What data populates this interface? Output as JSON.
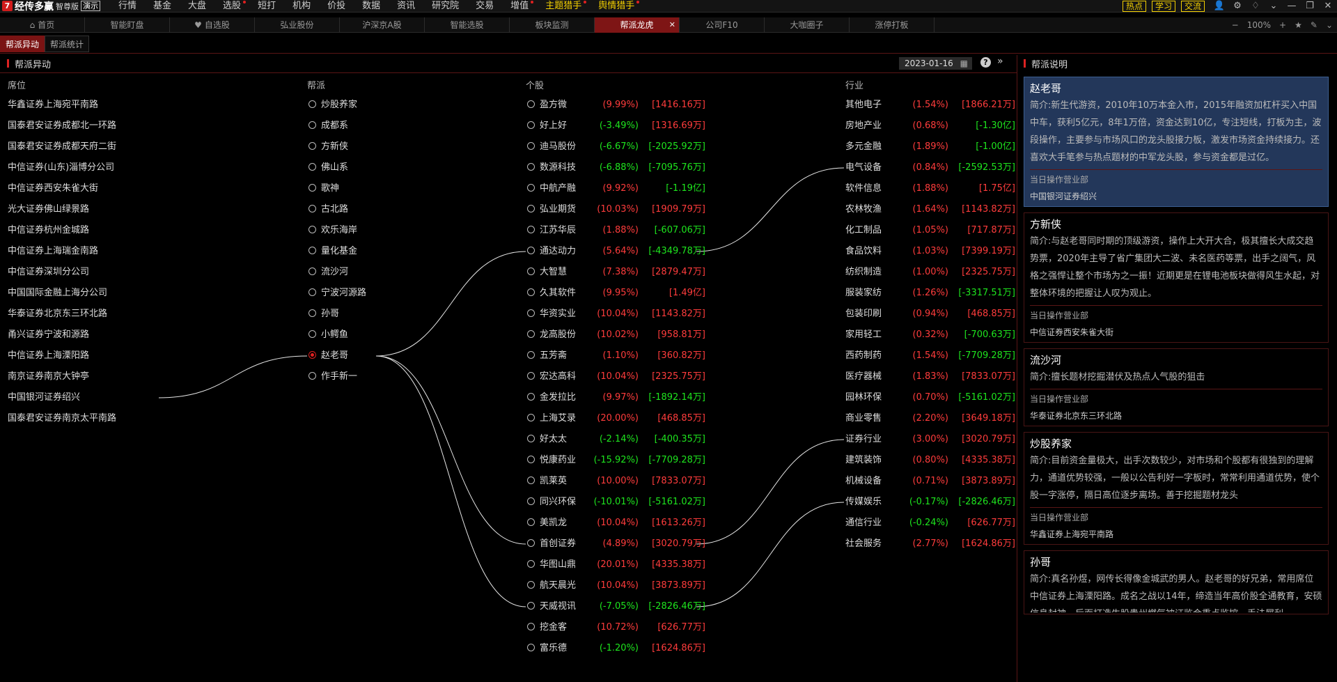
{
  "app": {
    "logo_glyph": "7",
    "name": "经传多赢",
    "edition": "智尊版",
    "demo": "演示"
  },
  "menu": [
    {
      "label": "行情",
      "dot": false,
      "hl": false
    },
    {
      "label": "基金",
      "dot": false,
      "hl": false
    },
    {
      "label": "大盘",
      "dot": false,
      "hl": false
    },
    {
      "label": "选股",
      "dot": true,
      "hl": false
    },
    {
      "label": "短打",
      "dot": false,
      "hl": false
    },
    {
      "label": "机构",
      "dot": false,
      "hl": false
    },
    {
      "label": "价投",
      "dot": false,
      "hl": false
    },
    {
      "label": "数据",
      "dot": false,
      "hl": false
    },
    {
      "label": "资讯",
      "dot": false,
      "hl": false
    },
    {
      "label": "研究院",
      "dot": false,
      "hl": false
    },
    {
      "label": "交易",
      "dot": false,
      "hl": false
    },
    {
      "label": "增值",
      "dot": true,
      "hl": false
    },
    {
      "label": "主题猎手",
      "dot": true,
      "hl": true
    },
    {
      "label": "舆情猎手",
      "dot": true,
      "hl": true
    }
  ],
  "top_buttons": [
    "热点",
    "学习",
    "交流"
  ],
  "top_icons": [
    "user-icon",
    "gear-icon",
    "skin-icon",
    "chevron-down-icon",
    "minimize-icon",
    "restore-icon",
    "close-icon"
  ],
  "tabs": [
    {
      "label": "首页",
      "active": false,
      "closable": false,
      "icon": "home"
    },
    {
      "label": "智能盯盘",
      "active": false,
      "closable": false
    },
    {
      "label": "自选股",
      "active": false,
      "closable": false,
      "icon": "heart"
    },
    {
      "label": "弘业股份",
      "active": false,
      "closable": false
    },
    {
      "label": "沪深京A股",
      "active": false,
      "closable": false
    },
    {
      "label": "智能选股",
      "active": false,
      "closable": false
    },
    {
      "label": "板块监测",
      "active": false,
      "closable": false
    },
    {
      "label": "帮派龙虎",
      "active": true,
      "closable": true
    },
    {
      "label": "公司F10",
      "active": false,
      "closable": false
    },
    {
      "label": "大咖圈子",
      "active": false,
      "closable": false
    },
    {
      "label": "涨停打板",
      "active": false,
      "closable": false
    }
  ],
  "zoom": {
    "minus": "−",
    "value": "100%",
    "plus": "+"
  },
  "subtabs": [
    {
      "label": "帮派异动",
      "active": true
    },
    {
      "label": "帮派统计",
      "active": false
    }
  ],
  "panel": {
    "title": "帮派异动",
    "date": "2023-01-16"
  },
  "columns": {
    "seat": "席位",
    "faction": "帮派",
    "stock": "个股",
    "industry": "行业"
  },
  "seats": [
    "华鑫证券上海宛平南路",
    "国泰君安证券成都北一环路",
    "国泰君安证券成都天府二街",
    "中信证券(山东)淄博分公司",
    "中信证券西安朱雀大街",
    "光大证券佛山绿景路",
    "中信证券杭州金城路",
    "中信证券上海瑞金南路",
    "中信证券深圳分公司",
    "中国国际金融上海分公司",
    "华泰证券北京东三环北路",
    "甬兴证券宁波和源路",
    "中信证券上海溧阳路",
    "南京证券南京大钟亭",
    "中国银河证券绍兴",
    "国泰君安证券南京太平南路"
  ],
  "factions": [
    {
      "name": "炒股养家",
      "selected": false
    },
    {
      "name": "成都系",
      "selected": false
    },
    {
      "name": "方新侠",
      "selected": false
    },
    {
      "name": "佛山系",
      "selected": false
    },
    {
      "name": "歌神",
      "selected": false
    },
    {
      "name": "古北路",
      "selected": false
    },
    {
      "name": "欢乐海岸",
      "selected": false
    },
    {
      "name": "量化基金",
      "selected": false
    },
    {
      "name": "流沙河",
      "selected": false
    },
    {
      "name": "宁波河源路",
      "selected": false
    },
    {
      "name": "孙哥",
      "selected": false
    },
    {
      "name": "小鳄鱼",
      "selected": false
    },
    {
      "name": "赵老哥",
      "selected": true
    },
    {
      "name": "作手新一",
      "selected": false
    }
  ],
  "stocks": [
    {
      "name": "盈方微",
      "pct": "(9.99%)",
      "amt": "[1416.16万]",
      "pos": true,
      "amt_pos": true
    },
    {
      "name": "好上好",
      "pct": "(-3.49%)",
      "amt": "[1316.69万]",
      "pos": false,
      "amt_pos": true
    },
    {
      "name": "迪马股份",
      "pct": "(-6.67%)",
      "amt": "[-2025.92万]",
      "pos": false,
      "amt_pos": false
    },
    {
      "name": "数源科技",
      "pct": "(-6.88%)",
      "amt": "[-7095.76万]",
      "pos": false,
      "amt_pos": false
    },
    {
      "name": "中航产融",
      "pct": "(9.92%)",
      "amt": "[-1.19亿]",
      "pos": true,
      "amt_pos": false
    },
    {
      "name": "弘业期货",
      "pct": "(10.03%)",
      "amt": "[1909.79万]",
      "pos": true,
      "amt_pos": true
    },
    {
      "name": "江苏华辰",
      "pct": "(1.88%)",
      "amt": "[-607.06万]",
      "pos": true,
      "amt_pos": false
    },
    {
      "name": "通达动力",
      "pct": "(5.64%)",
      "amt": "[-4349.78万]",
      "pos": true,
      "amt_pos": false
    },
    {
      "name": "大智慧",
      "pct": "(7.38%)",
      "amt": "[2879.47万]",
      "pos": true,
      "amt_pos": true
    },
    {
      "name": "久其软件",
      "pct": "(9.95%)",
      "amt": "[1.49亿]",
      "pos": true,
      "amt_pos": true
    },
    {
      "name": "华资实业",
      "pct": "(10.04%)",
      "amt": "[1143.82万]",
      "pos": true,
      "amt_pos": true
    },
    {
      "name": "龙高股份",
      "pct": "(10.02%)",
      "amt": "[958.81万]",
      "pos": true,
      "amt_pos": true
    },
    {
      "name": "五芳斋",
      "pct": "(1.10%)",
      "amt": "[360.82万]",
      "pos": true,
      "amt_pos": true
    },
    {
      "name": "宏达高科",
      "pct": "(10.04%)",
      "amt": "[2325.75万]",
      "pos": true,
      "amt_pos": true
    },
    {
      "name": "金发拉比",
      "pct": "(9.97%)",
      "amt": "[-1892.14万]",
      "pos": true,
      "amt_pos": false
    },
    {
      "name": "上海艾录",
      "pct": "(20.00%)",
      "amt": "[468.85万]",
      "pos": true,
      "amt_pos": true
    },
    {
      "name": "好太太",
      "pct": "(-2.14%)",
      "amt": "[-400.35万]",
      "pos": false,
      "amt_pos": false
    },
    {
      "name": "悦康药业",
      "pct": "(-15.92%)",
      "amt": "[-7709.28万]",
      "pos": false,
      "amt_pos": false
    },
    {
      "name": "凯莱英",
      "pct": "(10.00%)",
      "amt": "[7833.07万]",
      "pos": true,
      "amt_pos": true
    },
    {
      "name": "同兴环保",
      "pct": "(-10.01%)",
      "amt": "[-5161.02万]",
      "pos": false,
      "amt_pos": false
    },
    {
      "name": "美凯龙",
      "pct": "(10.04%)",
      "amt": "[1613.26万]",
      "pos": true,
      "amt_pos": true
    },
    {
      "name": "首创证券",
      "pct": "(4.89%)",
      "amt": "[3020.79万]",
      "pos": true,
      "amt_pos": true
    },
    {
      "name": "华图山鼎",
      "pct": "(20.01%)",
      "amt": "[4335.38万]",
      "pos": true,
      "amt_pos": true
    },
    {
      "name": "航天晨光",
      "pct": "(10.04%)",
      "amt": "[3873.89万]",
      "pos": true,
      "amt_pos": true
    },
    {
      "name": "天威视讯",
      "pct": "(-7.05%)",
      "amt": "[-2826.46万]",
      "pos": false,
      "amt_pos": false
    },
    {
      "name": "挖金客",
      "pct": "(10.72%)",
      "amt": "[626.77万]",
      "pos": true,
      "amt_pos": true
    },
    {
      "name": "富乐德",
      "pct": "(-1.20%)",
      "amt": "[1624.86万]",
      "pos": false,
      "amt_pos": true
    }
  ],
  "industries": [
    {
      "name": "其他电子",
      "pct": "(1.54%)",
      "amt": "[1866.21万]",
      "pos": true,
      "amt_pos": true
    },
    {
      "name": "房地产业",
      "pct": "(0.68%)",
      "amt": "[-1.30亿]",
      "pos": true,
      "amt_pos": false
    },
    {
      "name": "多元金融",
      "pct": "(1.89%)",
      "amt": "[-1.00亿]",
      "pos": true,
      "amt_pos": false
    },
    {
      "name": "电气设备",
      "pct": "(0.84%)",
      "amt": "[-2592.53万]",
      "pos": true,
      "amt_pos": false
    },
    {
      "name": "软件信息",
      "pct": "(1.88%)",
      "amt": "[1.75亿]",
      "pos": true,
      "amt_pos": true
    },
    {
      "name": "农林牧渔",
      "pct": "(1.64%)",
      "amt": "[1143.82万]",
      "pos": true,
      "amt_pos": true
    },
    {
      "name": "化工制品",
      "pct": "(1.05%)",
      "amt": "[717.87万]",
      "pos": true,
      "amt_pos": true
    },
    {
      "name": "食品饮料",
      "pct": "(1.03%)",
      "amt": "[7399.19万]",
      "pos": true,
      "amt_pos": true
    },
    {
      "name": "纺织制造",
      "pct": "(1.00%)",
      "amt": "[2325.75万]",
      "pos": true,
      "amt_pos": true
    },
    {
      "name": "服装家纺",
      "pct": "(1.26%)",
      "amt": "[-3317.51万]",
      "pos": true,
      "amt_pos": false
    },
    {
      "name": "包装印刷",
      "pct": "(0.94%)",
      "amt": "[468.85万]",
      "pos": true,
      "amt_pos": true
    },
    {
      "name": "家用轻工",
      "pct": "(0.32%)",
      "amt": "[-700.63万]",
      "pos": true,
      "amt_pos": false
    },
    {
      "name": "西药制药",
      "pct": "(1.54%)",
      "amt": "[-7709.28万]",
      "pos": true,
      "amt_pos": false
    },
    {
      "name": "医疗器械",
      "pct": "(1.83%)",
      "amt": "[7833.07万]",
      "pos": true,
      "amt_pos": true
    },
    {
      "name": "园林环保",
      "pct": "(0.70%)",
      "amt": "[-5161.02万]",
      "pos": true,
      "amt_pos": false
    },
    {
      "name": "商业零售",
      "pct": "(2.20%)",
      "amt": "[3649.18万]",
      "pos": true,
      "amt_pos": true
    },
    {
      "name": "证券行业",
      "pct": "(3.00%)",
      "amt": "[3020.79万]",
      "pos": true,
      "amt_pos": true
    },
    {
      "name": "建筑装饰",
      "pct": "(0.80%)",
      "amt": "[4335.38万]",
      "pos": true,
      "amt_pos": true
    },
    {
      "name": "机械设备",
      "pct": "(0.71%)",
      "amt": "[3873.89万]",
      "pos": true,
      "amt_pos": true
    },
    {
      "name": "传媒娱乐",
      "pct": "(-0.17%)",
      "amt": "[-2826.46万]",
      "pos": false,
      "amt_pos": false
    },
    {
      "name": "通信行业",
      "pct": "(-0.24%)",
      "amt": "[626.77万]",
      "pos": false,
      "amt_pos": true
    },
    {
      "name": "社会服务",
      "pct": "(2.77%)",
      "amt": "[1624.86万]",
      "pos": true,
      "amt_pos": true
    }
  ],
  "links": {
    "seat_faction": [
      [
        14,
        12
      ]
    ],
    "faction_stock": [
      [
        12,
        7
      ],
      [
        12,
        21
      ],
      [
        12,
        24
      ]
    ],
    "stock_industry": [
      [
        7,
        3
      ],
      [
        21,
        16
      ],
      [
        24,
        19
      ]
    ]
  },
  "right_panel": {
    "title": "帮派说明",
    "cards": [
      {
        "name": "赵老哥",
        "selected": true,
        "intro": "简介:新生代游资，2010年10万本金入市，2015年融资加杠杆买入中国中车，获利5亿元，8年1万倍，资金达到10亿，专注短线，打板为主，波段操作，主要参与市场风口的龙头股接力板，激发市场资金持续接力。还喜欢大手笔参与热点题材的中军龙头股，参与资金都是过亿。",
        "op_label": "当日操作营业部",
        "branch": "中国银河证券绍兴"
      },
      {
        "name": "方新侠",
        "selected": false,
        "intro": "简介:与赵老哥同时期的顶级游资，操作上大开大合，极其擅长大成交趋势票，2020年主导了省广集团大二波、未名医药等票，出手之阔气，风格之强悍让整个市场为之一振！近期更是在锂电池板块做得风生水起，对整体环境的把握让人叹为观止。",
        "op_label": "当日操作营业部",
        "branch": "中信证券西安朱雀大街"
      },
      {
        "name": "流沙河",
        "selected": false,
        "intro": "简介:擅长题材挖掘潜伏及热点人气股的狙击",
        "op_label": "当日操作营业部",
        "branch": "华泰证券北京东三环北路"
      },
      {
        "name": "炒股养家",
        "selected": false,
        "intro": "简介:目前资金量极大，出手次数较少，对市场和个股都有很独到的理解力，通道优势较强，一般以公告利好一字板时，常常利用通道优势，使个股一字涨停，隔日高位逐步离场。善于挖掘题材龙头",
        "op_label": "当日操作营业部",
        "branch": "华鑫证券上海宛平南路"
      },
      {
        "name": "孙哥",
        "selected": false,
        "intro": "简介:真名孙煜，网传长得像金城武的男人。赵老哥的好兄弟，常用席位中信证券上海溧阳路。成名之战以14年，缔造当年高价股全通教育，安硕信息封神，后面打造牛股贵州燃气被证监会重点监控，手法犀利，..",
        "op_label": "",
        "branch": ""
      }
    ]
  }
}
